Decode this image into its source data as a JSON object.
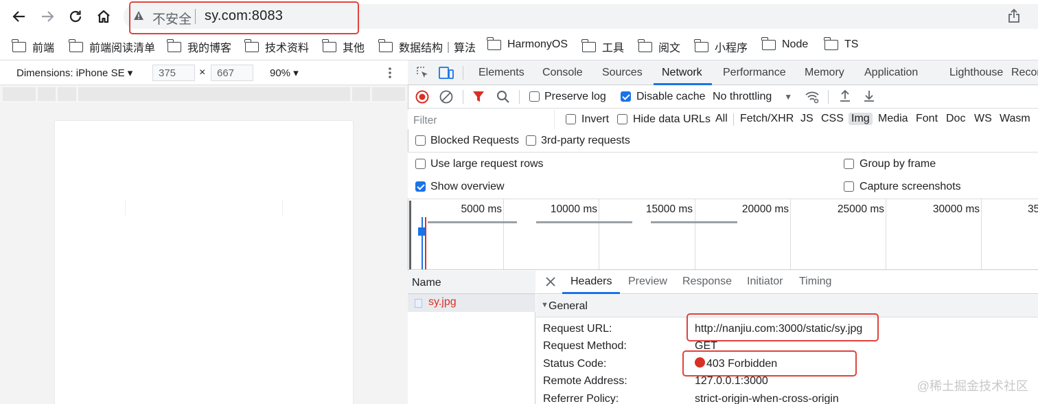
{
  "browser": {
    "security_label": "不安全",
    "url": "sy.com:8083"
  },
  "bookmarks": [
    "前端",
    "前端阅读清单",
    "我的博客",
    "技术资料",
    "其他",
    "数据结构｜算法",
    "HarmonyOS",
    "工具",
    "阅文",
    "小程序",
    "Node",
    "TS"
  ],
  "device_toolbar": {
    "dimensions_label": "Dimensions: iPhone SE",
    "width": "375",
    "times": "×",
    "height": "667",
    "zoom": "90%"
  },
  "devtools": {
    "tabs": [
      "Elements",
      "Console",
      "Sources",
      "Network",
      "Performance",
      "Memory",
      "Application",
      "Lighthouse",
      "Recor"
    ],
    "active_tab": "Network",
    "toolbar": {
      "preserve_log": "Preserve log",
      "disable_cache": "Disable cache",
      "throttling": "No throttling"
    },
    "filter": {
      "placeholder": "Filter",
      "invert": "Invert",
      "hide_data_urls": "Hide data URLs",
      "types": [
        "All",
        "Fetch/XHR",
        "JS",
        "CSS",
        "Img",
        "Media",
        "Font",
        "Doc",
        "WS",
        "Wasm"
      ],
      "selected_type": "Img",
      "blocked_requests": "Blocked Requests",
      "third_party": "3rd-party requests"
    },
    "settings": {
      "large_rows": "Use large request rows",
      "group_by_frame": "Group by frame",
      "show_overview": "Show overview",
      "capture_screenshots": "Capture screenshots"
    },
    "timeline_ticks": [
      "5000 ms",
      "10000 ms",
      "15000 ms",
      "20000 ms",
      "25000 ms",
      "30000 ms",
      "35"
    ],
    "request_list": {
      "header": "Name",
      "items": [
        "sy.jpg"
      ]
    },
    "detail": {
      "tabs": [
        "Headers",
        "Preview",
        "Response",
        "Initiator",
        "Timing"
      ],
      "active_tab": "Headers",
      "section": "General",
      "fields": [
        {
          "key": "Request URL:",
          "value": "http://nanjiu.com:3000/static/sy.jpg"
        },
        {
          "key": "Request Method:",
          "value": "GET"
        },
        {
          "key": "Status Code:",
          "value": "403 Forbidden"
        },
        {
          "key": "Remote Address:",
          "value": "127.0.0.1:3000"
        },
        {
          "key": "Referrer Policy:",
          "value": "strict-origin-when-cross-origin"
        }
      ]
    }
  },
  "watermark": "@稀土掘金技术社区",
  "colors": {
    "highlight_box": "#e0423b",
    "accent": "#1a73e8",
    "error": "#d93025",
    "status_dot": "#d93025"
  }
}
